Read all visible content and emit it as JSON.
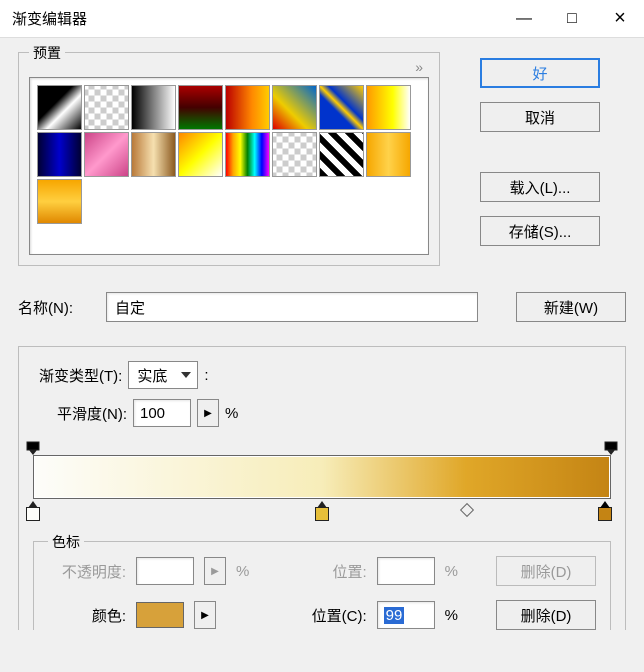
{
  "window": {
    "title": "渐变编辑器",
    "min": "—",
    "max": "□",
    "close": "×"
  },
  "presets": {
    "legend": "预置",
    "arrow": "»",
    "swatches": [
      "linear-gradient(135deg,#000 0%,#000 40%,#fff 60%,#000 100%)",
      "repeating-conic-gradient(#ccc 0 25%,#fff 0 50%) 50%/12px 12px",
      "linear-gradient(90deg,#000,#fff)",
      "linear-gradient(180deg,#a00 0%,#400 50%,#070 100%)",
      "linear-gradient(90deg,#b00 0%,#f80 60%,#fc0 100%)",
      "linear-gradient(45deg,#d00 0%,#ec0 40%,#06c 100%)",
      "linear-gradient(45deg,#03c 0%,#03c 40%,#fc0 50%,#03c 60%,#fc0 100%)",
      "linear-gradient(90deg,#f90 0%,#ff0 60%,#fff 100%)",
      "linear-gradient(90deg,#003,#00c,#003)",
      "linear-gradient(135deg,#c48,#f9c,#c48)",
      "linear-gradient(90deg,#b97a3a 0%,#f6e0b0 50%,#8c5a20 100%)",
      "linear-gradient(135deg,#f80 0%,#ff0 50%,#fff 100%)",
      "linear-gradient(90deg,red,orange,yellow,green,cyan,blue,magenta)",
      "repeating-conic-gradient(#ccc 0 25%,#fff 0 50%) 50%/12px 12px",
      "repeating-linear-gradient(45deg,#000 0 6px,#fff 6px 12px)",
      "linear-gradient(90deg,#f6a700,#ffd24a,#f6a700)",
      "linear-gradient(180deg,#f7a600 0%,#ffcf40 50%,#e08800 100%)"
    ]
  },
  "buttons": {
    "ok": "好",
    "cancel": "取消",
    "load": "载入(L)...",
    "save": "存储(S)...",
    "new": "新建(W)"
  },
  "name": {
    "label": "名称(N):",
    "value": "自定"
  },
  "grad": {
    "type_label": "渐变类型(T):",
    "type_value": "实底",
    "smooth_label": "平滑度(N):",
    "smooth_value": "100",
    "stepper_glyph": "▶",
    "pct": "%"
  },
  "editor": {
    "opacity_stops": [
      {
        "pos": 0,
        "color": "#000"
      },
      {
        "pos": 100,
        "color": "#000"
      }
    ],
    "color_stops": [
      {
        "pos": 0,
        "color": "#fdfdfa",
        "selected": false
      },
      {
        "pos": 50,
        "color": "#e6bf3a",
        "selected": false
      },
      {
        "pos": 99,
        "color": "#c48414",
        "selected": true
      }
    ],
    "midpoints": [
      {
        "pos": 75
      }
    ]
  },
  "stops": {
    "legend": "色标",
    "opacity_label": "不透明度:",
    "pos_label": "位置:",
    "pos_c_label": "位置(C):",
    "pos_c_value": "99",
    "delete_label": "删除(D)",
    "color_label": "颜色:",
    "color_value": "#d7a13a",
    "pct": "%"
  }
}
